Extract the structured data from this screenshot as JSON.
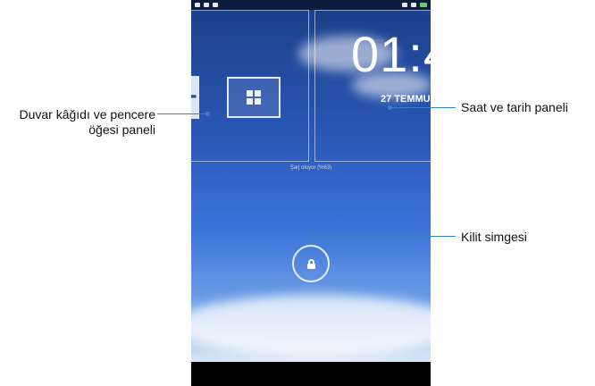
{
  "callouts": {
    "wallpaper_panel": [
      "Duvar kâğıdı ve pencere",
      "öğesi paneli"
    ],
    "clock_panel": "Saat ve tarih paneli",
    "lock_icon": "Kilit simgesi"
  },
  "lockscreen": {
    "clock_text": "01:4",
    "date_text": "27 TEMMU",
    "charging_text": "Şarj oluyor (%63)",
    "add_widget_symbol": "+"
  },
  "colors": {
    "callout_line": "#3b82c4",
    "sky_top": "#1b3f86",
    "sky_bottom": "#6d9fe6"
  },
  "icons": {
    "status_left": [
      "photo-icon",
      "sim-icon",
      "bag-icon"
    ],
    "status_right": [
      "signal-icon",
      "wifi-icon",
      "battery-icon"
    ],
    "widget": "widget-grid-icon",
    "lock": "lock-icon"
  }
}
